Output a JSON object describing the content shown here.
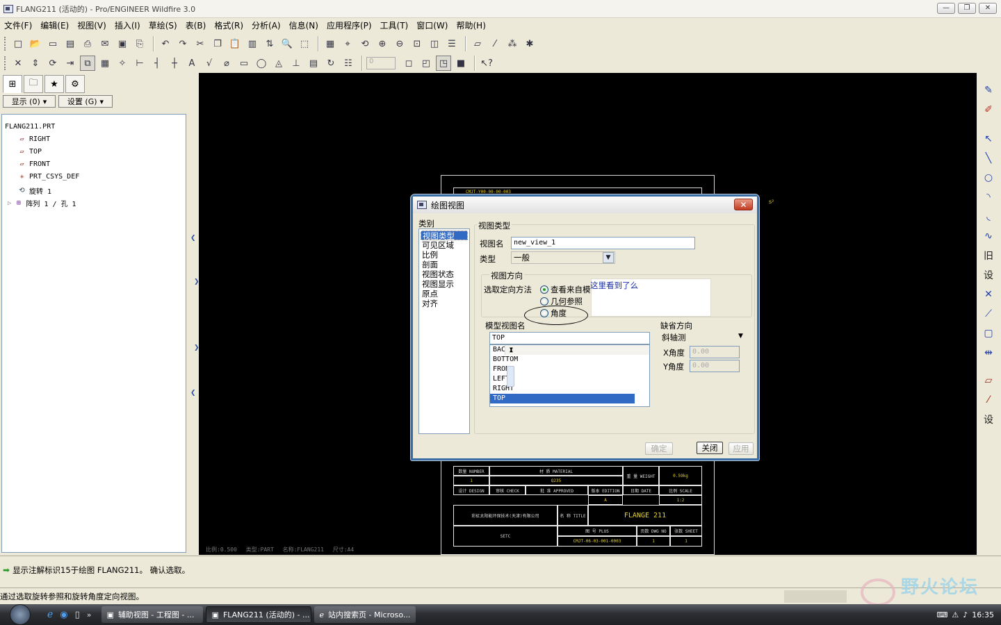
{
  "window": {
    "title": "FLANG211 (活动的) - Pro/ENGINEER Wildfire 3.0",
    "controls": [
      "—",
      "❐",
      "✕"
    ]
  },
  "menu": [
    "文件(F)",
    "编辑(E)",
    "视图(V)",
    "插入(I)",
    "草绘(S)",
    "表(B)",
    "格式(R)",
    "分析(A)",
    "信息(N)",
    "应用程序(P)",
    "工具(T)",
    "窗口(W)",
    "帮助(H)"
  ],
  "toolbar2": {
    "scale_value": "0"
  },
  "tree_panel": {
    "show_button": "显示 (0)",
    "settings_button": "设置 (G)",
    "items": [
      {
        "icon": "datum-plane-icon",
        "label": "FLANG211.PRT"
      },
      {
        "icon": "datum-plane-icon",
        "label": "RIGHT"
      },
      {
        "icon": "datum-plane-icon",
        "label": "TOP"
      },
      {
        "icon": "datum-plane-icon",
        "label": "FRONT"
      },
      {
        "icon": "csys-icon",
        "label": "PRT_CSYS_DEF"
      },
      {
        "icon": "revolve-icon",
        "label": "旋转 1"
      },
      {
        "icon": "pattern-icon",
        "label": "阵列 1 / 孔 1"
      }
    ]
  },
  "drawing": {
    "top_note": "CMJT-Y00-00-00-003",
    "superscript": "s²",
    "title_block": {
      "number_label": "数量 NUMBER",
      "number": "1",
      "material_label": "材 质 MATERIAL",
      "material": "Q235",
      "weight_label": "重 量 WEIGHT",
      "weight": "0.59kg",
      "design": "设计 DESIGN",
      "check": "审核 CHECK",
      "approved": "批 准 APPROVED",
      "edition_label": "版本 EDITION",
      "edition": "A",
      "date": "日期 DATE",
      "scale_label": "比例 SCALE",
      "scale": "1:2",
      "company": "彩虹太阳能环保技术(天津)有限公司",
      "company_code": "SETC",
      "title_label": "名 称 TITLE",
      "title": "FLANGE 211",
      "dwg_label": "图 号 PLUS",
      "dwg_no_label": "页数 DWG NO",
      "sheet_label": "张数 SHEET",
      "dwg_no": "CMJT-06-03-001-0003",
      "dwg_no_val": "1",
      "sheet": "1"
    },
    "status_bar": "比例:0.500 类型:PART 名称:FLANG211 尺寸:A4"
  },
  "dialog": {
    "title": "绘图视图",
    "categories_label": "类别",
    "categories": [
      "视图类型",
      "可见区域",
      "比例",
      "剖面",
      "视图状态",
      "视图显示",
      "原点",
      "对齐"
    ],
    "selected_category": "视图类型",
    "section_title": "视图类型",
    "view_name_label": "视图名",
    "view_name": "new_view_1",
    "type_label": "类型",
    "type_value": "一般",
    "orient_group": "视图方向",
    "orient_method_label": "选取定向方法",
    "orient_options": [
      "查看来自模",
      "几何参照",
      "角度"
    ],
    "orient_selected": "查看来自模",
    "annotation": "这里看到了么",
    "model_views_label": "模型视图名",
    "model_view_value": "TOP",
    "model_views": [
      "BACK",
      "BOTTOM",
      "FRONT",
      "LEFT",
      "RIGHT",
      "TOP"
    ],
    "selected_view": "TOP",
    "default_orient_label": "缺省方向",
    "default_orient_value": "斜轴测",
    "x_angle_label": "X角度",
    "x_angle": "0.00",
    "y_angle_label": "Y角度",
    "y_angle": "0.00",
    "ok_button": "确定",
    "close_button": "关闭",
    "apply_button": "应用"
  },
  "messages": {
    "message": "显示注解标识15于绘图 FLANG211。 确认选取。",
    "status": "通过选取旋转参照和旋转角度定向视图。"
  },
  "taskbar": {
    "tasks": [
      "辅助视图 - 工程图 - ...",
      "FLANG211 (活动的) - ...",
      "站内搜索页 - Microso..."
    ],
    "active_task": "FLANG211 (活动的) - ...",
    "clock": "16:35",
    "watermark": "野火论坛"
  },
  "colors": {
    "graphics_bg": "#000000",
    "accent": "#316ac5",
    "drawing_yellow": "#e8d32a"
  }
}
